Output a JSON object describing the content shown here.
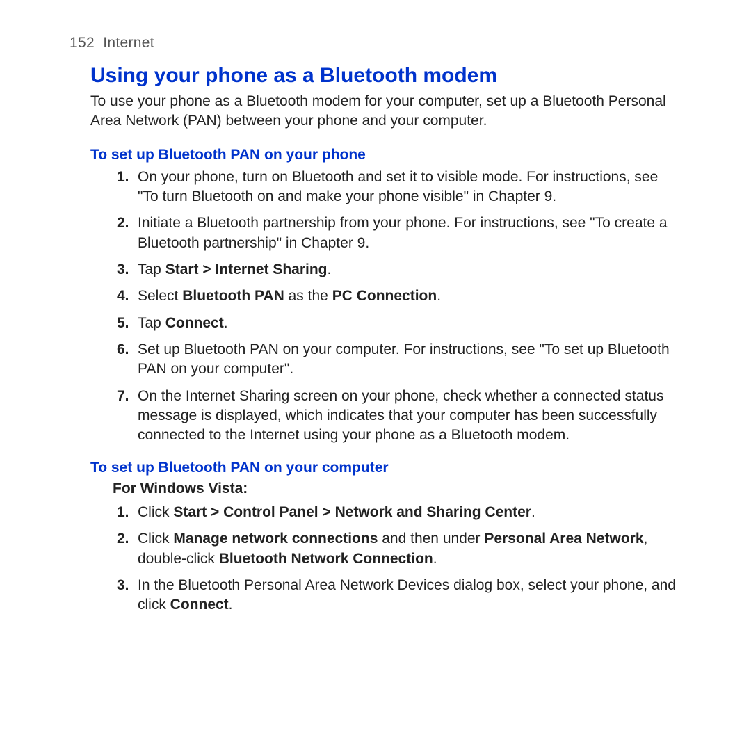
{
  "header": {
    "page_number": "152",
    "section": "Internet"
  },
  "main_heading": "Using your phone as a Bluetooth modem",
  "intro": "To use your phone as a Bluetooth modem for your computer, set up a Bluetooth Personal Area Network (PAN) between your phone and your computer.",
  "section1": {
    "heading": "To set up Bluetooth PAN on your phone",
    "steps": [
      {
        "num": "1.",
        "prefix": "",
        "bold1": "",
        "mid1": "On your phone, turn on Bluetooth and set it to visible mode. For instructions, see \"To turn Bluetooth on and make your phone visible\" in Chapter 9.",
        "bold2": "",
        "mid2": "",
        "bold3": "",
        "suffix": ""
      },
      {
        "num": "2.",
        "prefix": "",
        "bold1": "",
        "mid1": "Initiate a Bluetooth partnership from your phone. For instructions, see \"To create a Bluetooth partnership\" in Chapter 9.",
        "bold2": "",
        "mid2": "",
        "bold3": "",
        "suffix": ""
      },
      {
        "num": "3.",
        "prefix": "Tap ",
        "bold1": "Start > Internet Sharing",
        "mid1": ".",
        "bold2": "",
        "mid2": "",
        "bold3": "",
        "suffix": ""
      },
      {
        "num": "4.",
        "prefix": "Select ",
        "bold1": "Bluetooth PAN",
        "mid1": " as the ",
        "bold2": "PC Connection",
        "mid2": ".",
        "bold3": "",
        "suffix": ""
      },
      {
        "num": "5.",
        "prefix": "Tap ",
        "bold1": "Connect",
        "mid1": ".",
        "bold2": "",
        "mid2": "",
        "bold3": "",
        "suffix": ""
      },
      {
        "num": "6.",
        "prefix": "",
        "bold1": "",
        "mid1": "Set up Bluetooth PAN on your computer. For instructions, see \"To set up Bluetooth PAN on your computer\".",
        "bold2": "",
        "mid2": "",
        "bold3": "",
        "suffix": ""
      },
      {
        "num": "7.",
        "prefix": "",
        "bold1": "",
        "mid1": "On the Internet Sharing screen on your phone, check whether a connected status message is displayed, which indicates that your computer has been successfully connected to the Internet using your phone as a Bluetooth modem.",
        "bold2": "",
        "mid2": "",
        "bold3": "",
        "suffix": ""
      }
    ]
  },
  "section2": {
    "heading": "To set up Bluetooth PAN on your computer",
    "os_label": "For Windows Vista:",
    "steps": [
      {
        "num": "1.",
        "prefix": "Click ",
        "bold1": "Start > Control Panel > Network and Sharing Center",
        "mid1": ".",
        "bold2": "",
        "mid2": "",
        "bold3": "",
        "suffix": ""
      },
      {
        "num": "2.",
        "prefix": "Click ",
        "bold1": "Manage network connections",
        "mid1": " and then under ",
        "bold2": "Personal Area Network",
        "mid2": ", double-click ",
        "bold3": "Bluetooth Network Connection",
        "suffix": "."
      },
      {
        "num": "3.",
        "prefix": "",
        "bold1": "",
        "mid1": "In the Bluetooth Personal Area Network Devices dialog box, select your phone, and click ",
        "bold2": "Connect",
        "mid2": ".",
        "bold3": "",
        "suffix": ""
      }
    ]
  }
}
